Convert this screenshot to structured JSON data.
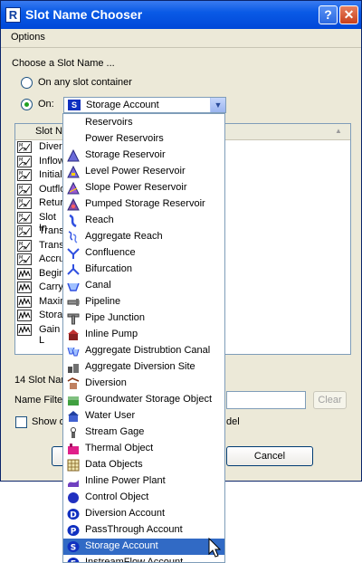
{
  "window": {
    "title": "Slot Name Chooser",
    "help_glyph": "?",
    "close_glyph": "✕",
    "app_icon": "R"
  },
  "menu": {
    "options": "Options"
  },
  "chooser": {
    "heading": "Choose a Slot Name ...",
    "radio_any": "On any slot container",
    "radio_on": "On:",
    "selected_value": "Storage Account",
    "selected_badge": "S"
  },
  "table": {
    "header": "Slot Na",
    "rows": [
      "Divers",
      "Inflow",
      "Initial",
      "Outflo",
      "Retur",
      "Slot In",
      "Transl",
      "Transl",
      "Accru",
      "Begin",
      "Carry",
      "Maxim",
      "Storag",
      "Gain L"
    ],
    "row_icons": [
      "M/A",
      "M/A",
      "M/A",
      "M/A",
      "M/A",
      "M/A",
      "M/A",
      "M/A",
      "M/A",
      "series",
      "series",
      "series",
      "series",
      "series"
    ]
  },
  "footer": {
    "count_label": "14 Slot Nam",
    "filter_label": "Name Filter",
    "clear_button": "Clear",
    "show_label": "Show o",
    "show_suffix": "del",
    "cancel_button": "Cancel"
  },
  "dropdown": {
    "items": [
      {
        "label": "Reservoirs",
        "icon": "none"
      },
      {
        "label": "Power Reservoirs",
        "icon": "none"
      },
      {
        "label": "Storage Reservoir",
        "icon": "storage-reservoir-icon"
      },
      {
        "label": "Level Power Reservoir",
        "icon": "level-power-reservoir-icon"
      },
      {
        "label": "Slope Power Reservoir",
        "icon": "slope-power-reservoir-icon"
      },
      {
        "label": "Pumped Storage Reservoir",
        "icon": "pumped-storage-reservoir-icon"
      },
      {
        "label": "Reach",
        "icon": "reach-icon"
      },
      {
        "label": "Aggregate Reach",
        "icon": "aggregate-reach-icon"
      },
      {
        "label": "Confluence",
        "icon": "confluence-icon"
      },
      {
        "label": "Bifurcation",
        "icon": "bifurcation-icon"
      },
      {
        "label": "Canal",
        "icon": "canal-icon"
      },
      {
        "label": "Pipeline",
        "icon": "pipeline-icon"
      },
      {
        "label": "Pipe Junction",
        "icon": "pipe-junction-icon"
      },
      {
        "label": "Inline Pump",
        "icon": "inline-pump-icon"
      },
      {
        "label": "Aggregate Distrubtion Canal",
        "icon": "aggregate-distribution-canal-icon"
      },
      {
        "label": "Aggregate Diversion Site",
        "icon": "aggregate-diversion-site-icon"
      },
      {
        "label": "Diversion",
        "icon": "diversion-icon"
      },
      {
        "label": "Groundwater Storage Object",
        "icon": "groundwater-storage-icon"
      },
      {
        "label": "Water User",
        "icon": "water-user-icon"
      },
      {
        "label": "Stream Gage",
        "icon": "stream-gage-icon"
      },
      {
        "label": "Thermal Object",
        "icon": "thermal-object-icon"
      },
      {
        "label": "Data Objects",
        "icon": "data-objects-icon"
      },
      {
        "label": "Inline Power Plant",
        "icon": "inline-power-plant-icon"
      },
      {
        "label": "Control Object",
        "icon": "control-object-icon"
      },
      {
        "label": "Diversion Account",
        "icon": "diversion-account-icon",
        "badge": "D"
      },
      {
        "label": "PassThrough Account",
        "icon": "passthrough-account-icon",
        "badge": "P"
      },
      {
        "label": "Storage Account",
        "icon": "storage-account-icon",
        "badge": "S"
      },
      {
        "label": "InstreamFlow Account",
        "icon": "instreamflow-account-icon",
        "badge": "F"
      }
    ],
    "selected_index": 26
  },
  "colors": {
    "title_bar": "#0a5ae6",
    "selection": "#316ac5",
    "badge_blue": "#1030c0",
    "window_bg": "#ece9d8"
  }
}
